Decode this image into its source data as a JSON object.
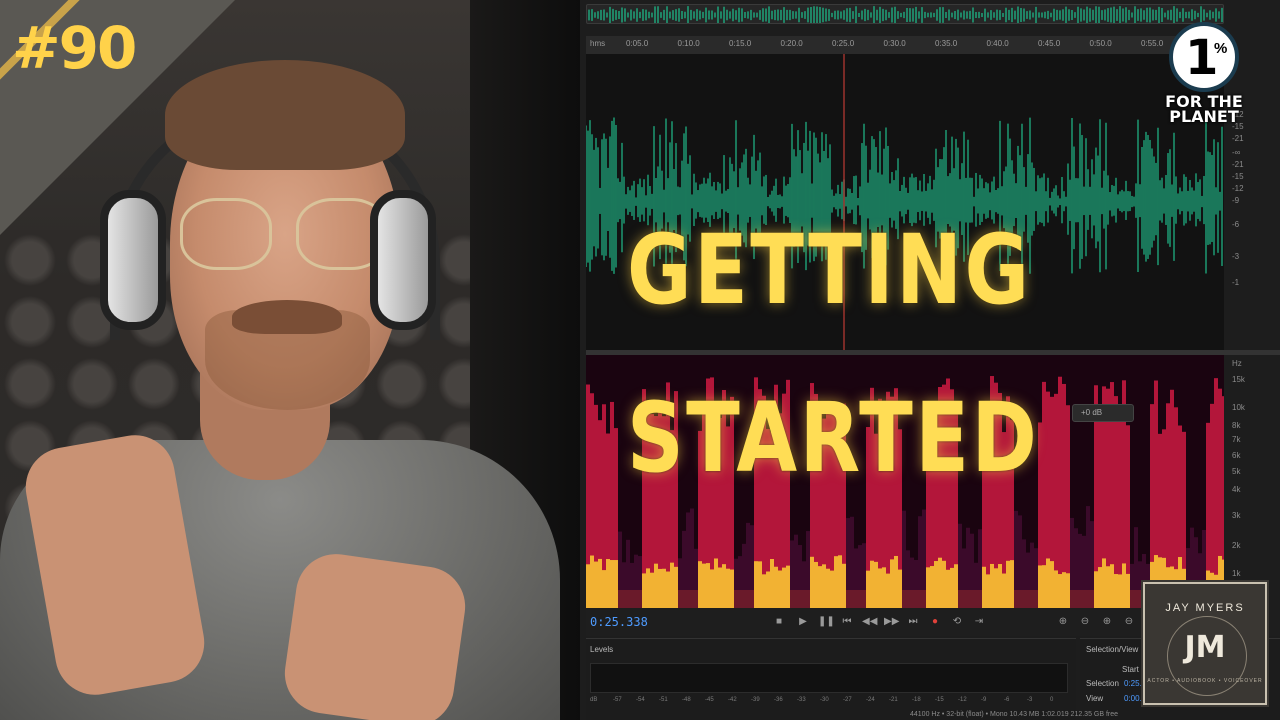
{
  "badge": {
    "episode": "#90"
  },
  "title": {
    "line1": "GETTING",
    "line2": "STARTED"
  },
  "logos": {
    "ftp_numeral": "1",
    "ftp_percent": "%",
    "ftp_text": "FOR THE PLANET",
    "jm_name": "JAY MYERS",
    "jm_monogram": "JM",
    "jm_tagline": "ACTOR • AUDIOBOOK • VOICEOVER"
  },
  "editor": {
    "ruler": {
      "unit": "hms",
      "ticks": [
        "0:05.0",
        "0:10.0",
        "0:15.0",
        "0:20.0",
        "0:25.0",
        "0:30.0",
        "0:35.0",
        "0:40.0",
        "0:45.0",
        "0:50.0",
        "0:55.0"
      ]
    },
    "db_scale": [
      "-9",
      "-12",
      "-15",
      "-21",
      "-∞",
      "-21",
      "-15",
      "-12",
      "-9",
      "-6",
      "-3",
      "-1"
    ],
    "hz_scale": [
      "Hz",
      "15k",
      "10k",
      "8k",
      "7k",
      "6k",
      "5k",
      "4k",
      "3k",
      "2k",
      "1k"
    ],
    "gain_chip": "+0 dB",
    "timecode": "0:25.338",
    "levels_title": "Levels",
    "levels_scale": [
      "dB",
      "-57",
      "-54",
      "-51",
      "-48",
      "-45",
      "-42",
      "-39",
      "-36",
      "-33",
      "-30",
      "-27",
      "-24",
      "-21",
      "-18",
      "-15",
      "-12",
      "-9",
      "-6",
      "-3",
      "0"
    ],
    "selection_view": {
      "title": "Selection/View",
      "start_label": "Start",
      "start_value": "0:25.",
      "selection_label": "Selection",
      "view_label": "View",
      "view_value": "0:00."
    },
    "status_bar": "44100 Hz • 32-bit (float) • Mono     10.43 MB     1:02.019     212.35 GB free",
    "colors": {
      "waveform": "#1fa37a",
      "playhead": "#e0413a",
      "timecode": "#4e9bff",
      "title_yellow": "#ffdd55"
    }
  }
}
